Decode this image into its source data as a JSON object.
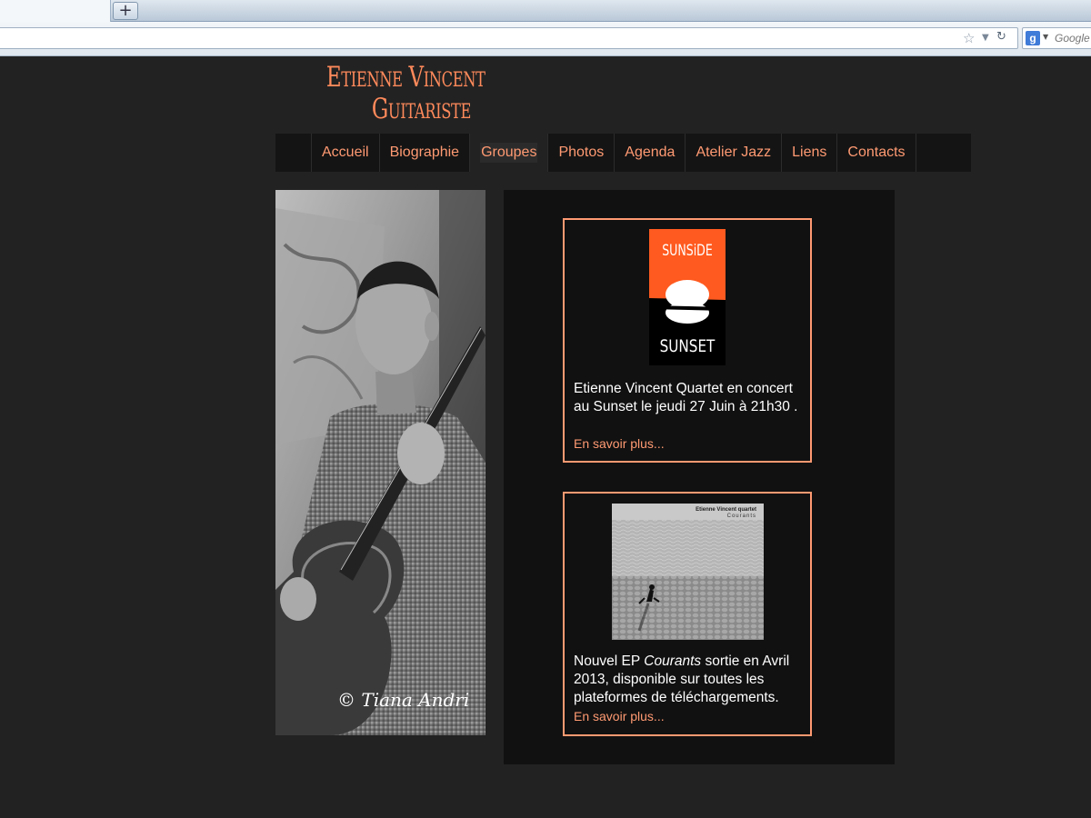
{
  "browser": {
    "new_tab_glyph": "+",
    "search_engine_label": "Google",
    "search_engine_icon": "g",
    "star_icon": "star-icon",
    "reload_icon": "reload-icon"
  },
  "site": {
    "title_line1": "Etienne Vincent",
    "title_line2": "Guitariste",
    "accent_color": "#ff9a72"
  },
  "menu": {
    "items": [
      {
        "label": "Accueil"
      },
      {
        "label": "Biographie"
      },
      {
        "label": "Groupes",
        "active": true
      },
      {
        "label": "Photos"
      },
      {
        "label": "Agenda"
      },
      {
        "label": "Atelier Jazz"
      },
      {
        "label": "Liens"
      },
      {
        "label": "Contacts"
      }
    ]
  },
  "photo": {
    "credit": "© Tiana Andri"
  },
  "news": [
    {
      "image_top": "SUNSiDE",
      "image_bottom": "SUNSET",
      "text": "Etienne Vincent Quartet en concert au Sunset le jeudi 27 Juin à 21h30 .",
      "more_label": "En savoir plus..."
    },
    {
      "image_caption1": "Etienne Vincent quartet",
      "image_caption2": "Courants",
      "text_before": "Nouvel EP ",
      "text_em": "Courants",
      "text_after": " sortie en Avril 2013, disponible sur toutes les plateformes de téléchargements.",
      "more_label": "En savoir plus..."
    }
  ]
}
